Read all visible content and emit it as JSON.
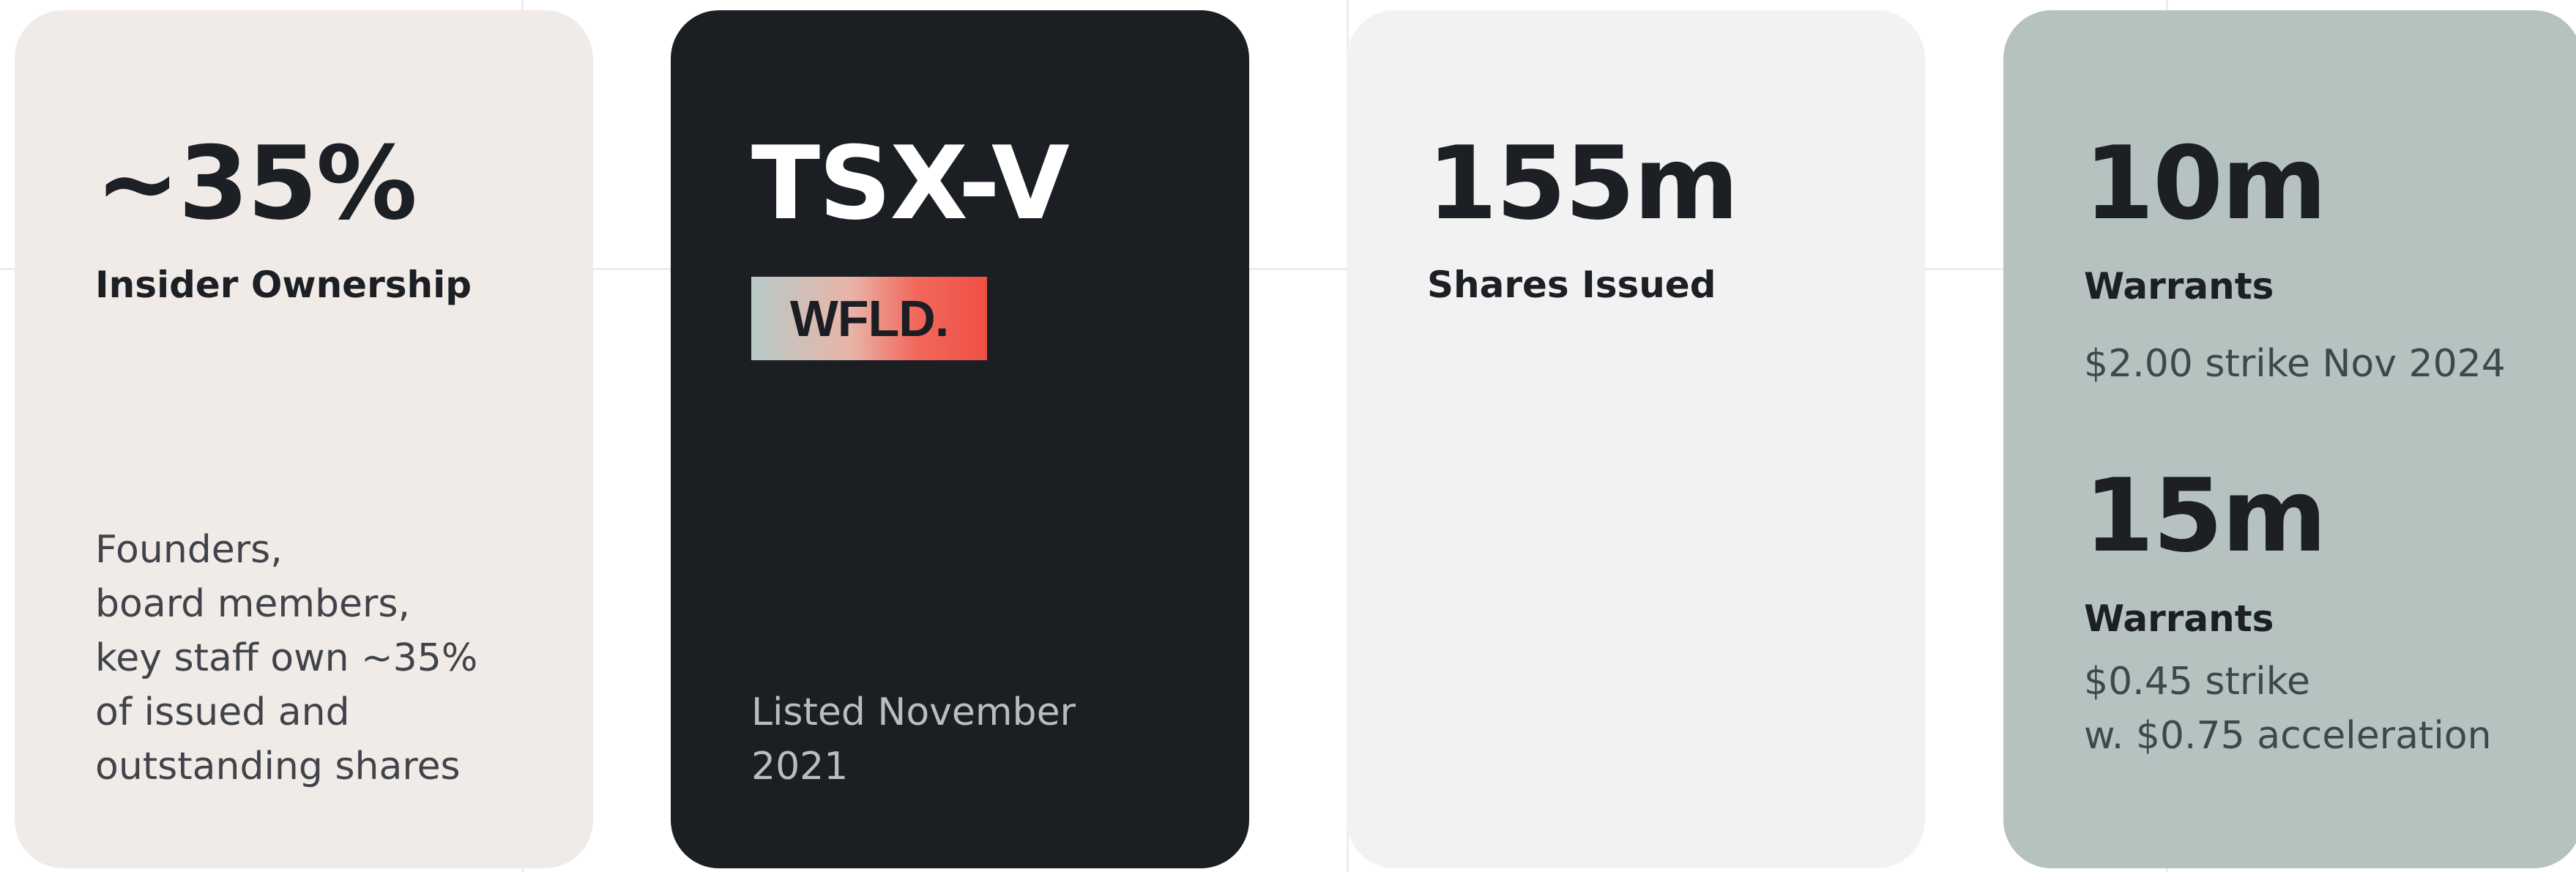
{
  "colors": {
    "card1_bg": "#f1ebe8",
    "card2_bg": "#1b1e23",
    "card3_bg": "#f2f2f2",
    "card4_bg": "#b6c2c0",
    "badge_gradient": [
      "#b7cac8",
      "#e9b4a8",
      "#f2685c",
      "#f04f45"
    ]
  },
  "cards": {
    "insider": {
      "value": "~35%",
      "label": "Insider Ownership",
      "description_lines": [
        "Founders,",
        "board members,",
        "key staff own ~35%",
        "of issued and",
        "outstanding shares"
      ]
    },
    "exchange": {
      "value": "TSX-V",
      "ticker": "WFLD.",
      "listed_lines": [
        "Listed November",
        "2021"
      ]
    },
    "shares": {
      "value": "155m",
      "label": "Shares Issued"
    },
    "warrants": {
      "first": {
        "value": "10m",
        "label": "Warrants",
        "detail_lines": [
          "$2.00 strike Nov 2024"
        ]
      },
      "second": {
        "value": "15m",
        "label": "Warrants",
        "detail_lines": [
          "$0.45 strike",
          "w. $0.75 acceleration"
        ]
      }
    }
  }
}
